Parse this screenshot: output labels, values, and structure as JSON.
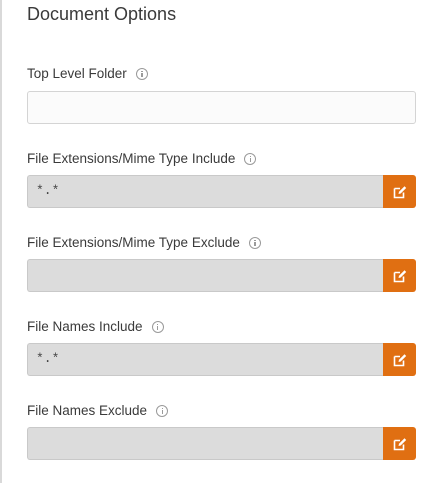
{
  "section": {
    "title": "Document Options"
  },
  "fields": {
    "top_level_folder": {
      "label": "Top Level Folder",
      "value": ""
    },
    "ext_include": {
      "label": "File Extensions/Mime Type Include",
      "value": "*.*"
    },
    "ext_exclude": {
      "label": "File Extensions/Mime Type Exclude",
      "value": ""
    },
    "names_include": {
      "label": "File Names Include",
      "value": "*.*"
    },
    "names_exclude": {
      "label": "File Names Exclude",
      "value": ""
    }
  },
  "icons": {
    "info": "info-icon",
    "edit": "edit-icon"
  },
  "colors": {
    "edit_button": "#e06f12",
    "readonly_bg": "#dcdcdc"
  }
}
